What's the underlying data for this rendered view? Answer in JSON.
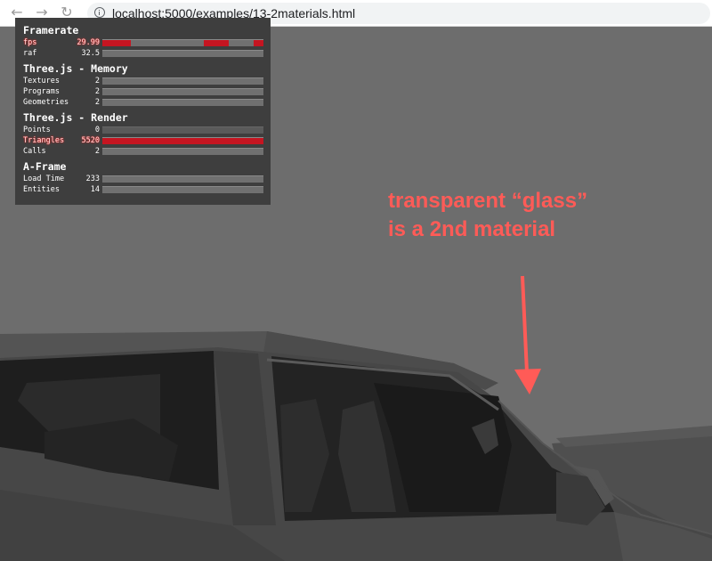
{
  "browser": {
    "url": "localhost:5000/examples/13-2materials.html",
    "back_icon": "arrow-left",
    "forward_icon": "arrow-right",
    "reload_icon": "reload"
  },
  "stats": {
    "framerate_title": "Framerate",
    "memory_title": "Three.js - Memory",
    "render_title": "Three.js - Render",
    "aframe_title": "A-Frame",
    "rows": {
      "fps": {
        "label": "fps",
        "value": "29.99"
      },
      "raf": {
        "label": "raf",
        "value": "32.5"
      },
      "textures": {
        "label": "Textures",
        "value": "2"
      },
      "programs": {
        "label": "Programs",
        "value": "2"
      },
      "geometries": {
        "label": "Geometries",
        "value": "2"
      },
      "points": {
        "label": "Points",
        "value": "0"
      },
      "triangles": {
        "label": "Triangles",
        "value": "5520",
        "fill": 1.0
      },
      "calls": {
        "label": "Calls",
        "value": "2"
      },
      "load_time": {
        "label": "Load Time",
        "value": "233"
      },
      "entities": {
        "label": "Entities",
        "value": "14"
      }
    },
    "alarm_color": "#c51521"
  },
  "annotation": {
    "line1": "transparent “glass”",
    "line2": "is a 2nd material",
    "color": "#ff5b57"
  },
  "scene": {
    "background": "#6d6d6d",
    "car_color": "#4a4a4a"
  }
}
